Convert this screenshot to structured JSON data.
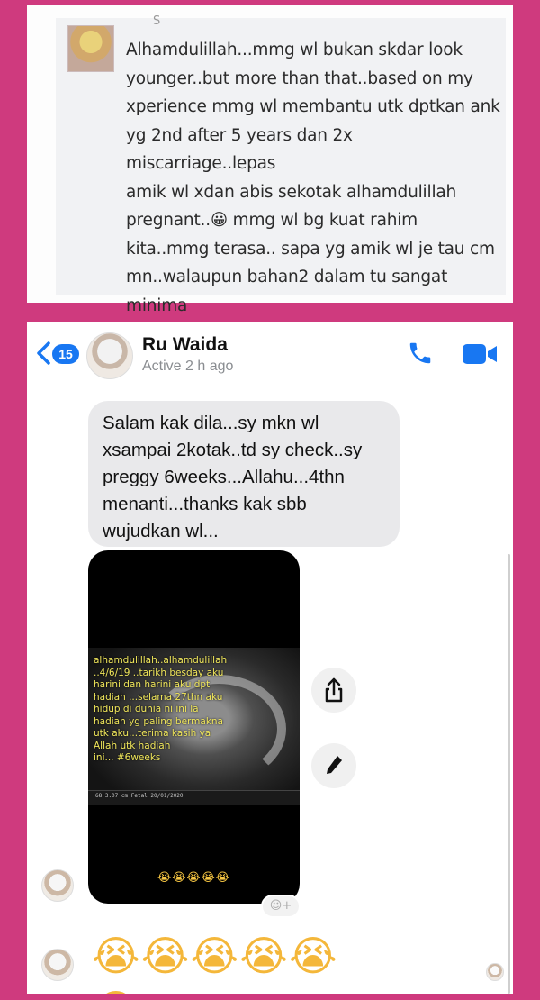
{
  "facebook_comment": {
    "commenter_name": "S",
    "text": "Alhamdulillah...mmg wl bukan skdar look\nyounger..but more than that..based on my\nxperience mmg wl membantu utk dptkan ank\nyg 2nd after 5 years dan 2x miscarriage..lepas\namik wl xdan abis sekotak alhamdulillah\npregnant..😀 mmg wl bg kuat rahim\nkita..mmg terasa.. sapa yg amik wl je tau cm\nmn..walaupun bahan2 dalam tu sangat minima\ntapi kesan dia mmg wowww...syukur pd\nAllah..tq pn dila..kena hasilkan produk superb\nutk wanita😘😘😘😘love u puan.."
  },
  "messenger": {
    "header": {
      "back_badge_count": "15",
      "contact_name": "Ru Waida",
      "status": "Active 2 h ago"
    },
    "message_text": "Salam kak dila...sy mkn wl\nxsampai 2kotak..td sy check..sy\npreggy 6weeks...Allahu...4thn\nmenanti...thanks kak sbb\nwujudkan wl...",
    "photo": {
      "caption": "alhamdulillah..alhamdulillah\n..4/6/19 ..tarikh besday aku\nharini dan harini aku dpt\nhadiah ...selama 27thn aku\nhidup di dunia ni ini la\nhadiah yg paling bermakna\nutk aku...terima kasih ya\nAllah utk hadiah\nini... #6weeks",
      "status_bar_text": "68  3.07 cm  Fetal 20/01/2020",
      "emoji_strip": "😭😭😭😭😭"
    },
    "reaction_add_label": "☺+",
    "emoji_message": "😭😭😭😭😭😭"
  },
  "colors": {
    "background": "#cf3a7e",
    "messenger_blue": "#1877f2",
    "bubble_gray": "#e9e9eb"
  },
  "icons": {
    "back": "chevron-left-icon",
    "call": "phone-icon",
    "video": "video-camera-icon",
    "share": "share-icon",
    "edit": "pencil-icon"
  }
}
